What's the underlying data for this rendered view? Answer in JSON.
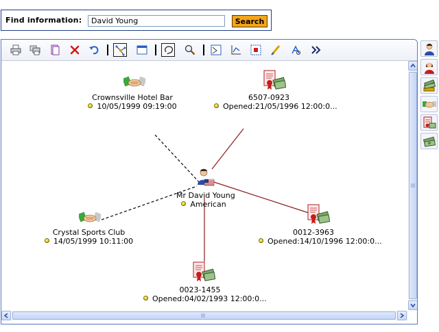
{
  "search": {
    "label": "Find information:",
    "value": "David Young",
    "button_label": "Search"
  },
  "toolbar": {
    "buttons": [
      {
        "name": "print-icon"
      },
      {
        "name": "print-all-icon"
      },
      {
        "name": "copy-icon"
      },
      {
        "name": "delete-icon"
      },
      {
        "name": "undo-icon"
      },
      {
        "name": "network-layout-icon",
        "pressed": true
      },
      {
        "name": "window-icon"
      },
      {
        "name": "lasso-select-icon",
        "pressed": true
      },
      {
        "name": "zoom-icon"
      },
      {
        "name": "expand-node-icon"
      },
      {
        "name": "chart-icon"
      },
      {
        "name": "grid-select-icon"
      },
      {
        "name": "highlight-icon"
      },
      {
        "name": "find-icon"
      },
      {
        "name": "more-icon"
      }
    ]
  },
  "graph": {
    "center": {
      "name": "Mr David Young",
      "detail": "American",
      "icon": "person-us-flag-icon"
    },
    "nodes": [
      {
        "id": "crownsville",
        "icon": "handshake-icon",
        "title": "Crownsville Hotel Bar",
        "detail": "10/05/1999 09:19:00",
        "link": "dashed"
      },
      {
        "id": "acct-6507",
        "icon": "certificate-money-icon",
        "title": "6507-0923",
        "detail": "Opened:21/05/1996 12:00:0...",
        "link": "solid"
      },
      {
        "id": "crystal",
        "icon": "handshake-icon",
        "title": "Crystal Sports Club",
        "detail": "14/05/1999 10:11:00",
        "link": "dashed"
      },
      {
        "id": "acct-0012",
        "icon": "certificate-money-icon",
        "title": "0012-3963",
        "detail": "Opened:14/10/1996 12:00:0...",
        "link": "solid"
      },
      {
        "id": "acct-0023",
        "icon": "certificate-money-icon",
        "title": "0023-1455",
        "detail": "Opened:04/02/1993 12:00:0...",
        "link": "solid"
      }
    ]
  },
  "sidebar": {
    "tabs": [
      {
        "name": "person-male-icon"
      },
      {
        "name": "person-female-icon"
      },
      {
        "name": "money-stack-icon"
      },
      {
        "name": "handshake-icon"
      },
      {
        "name": "certificate-money-icon"
      },
      {
        "name": "money-bills-icon"
      }
    ]
  },
  "colors": {
    "panel_border": "#1f3c88",
    "search_button": "#f4a51c",
    "solid_link": "#8b1a1a",
    "dashed_link": "#000000"
  }
}
